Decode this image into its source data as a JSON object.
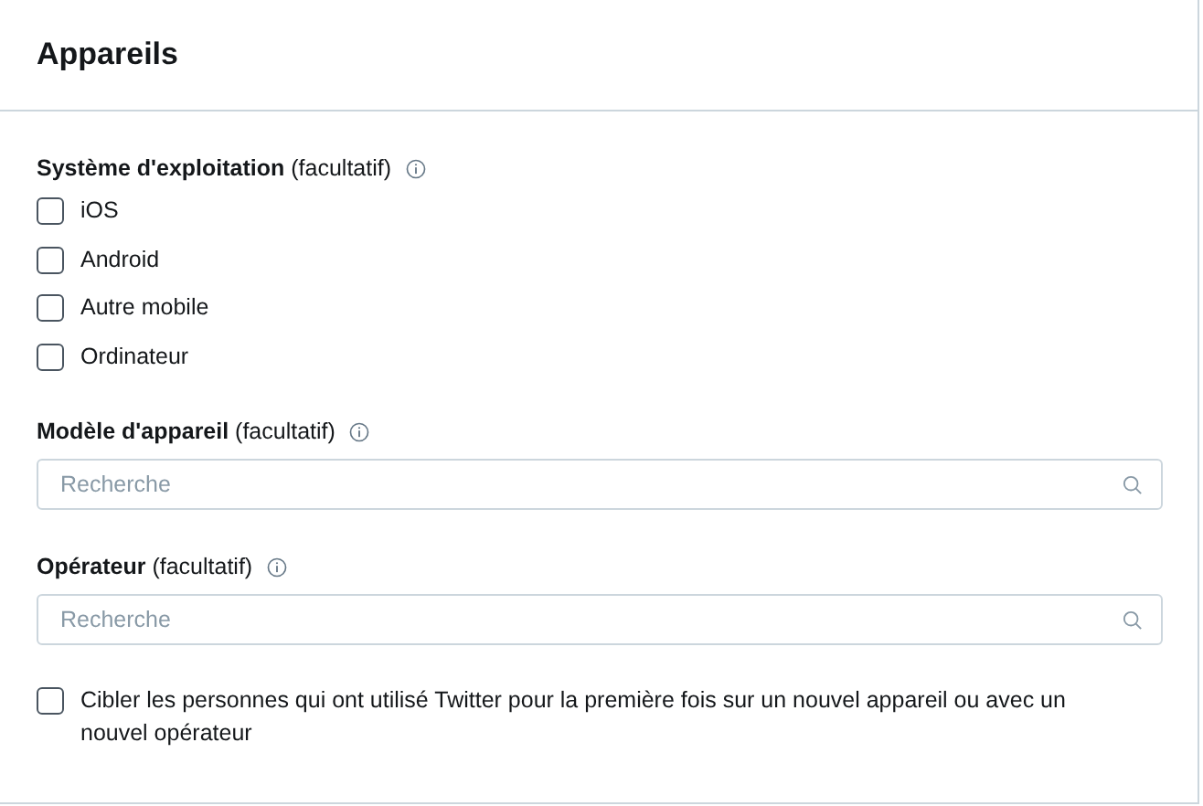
{
  "title": "Appareils",
  "sections": [
    {
      "kind": "checklist",
      "label": "**Système d'exploitation** (facultatif)",
      "options": [
        {
          "label": "iOS",
          "checked": false
        },
        {
          "label": "Android",
          "checked": false
        },
        {
          "label": "Autre mobile",
          "checked": false
        },
        {
          "label": "Ordinateur",
          "checked": false
        }
      ]
    },
    {
      "kind": "search",
      "label": "**Modèle d'appareil** (facultatif)",
      "placeholder": "Recherche"
    },
    {
      "kind": "search",
      "label": "**Opérateur** (facultatif)",
      "placeholder": "Recherche"
    },
    {
      "kind": "option",
      "label": "Cibler les personnes qui ont utilisé Twitter pour la première fois sur un nouvel appareil ou avec un nouvel opérateur",
      "checked": false
    }
  ]
}
